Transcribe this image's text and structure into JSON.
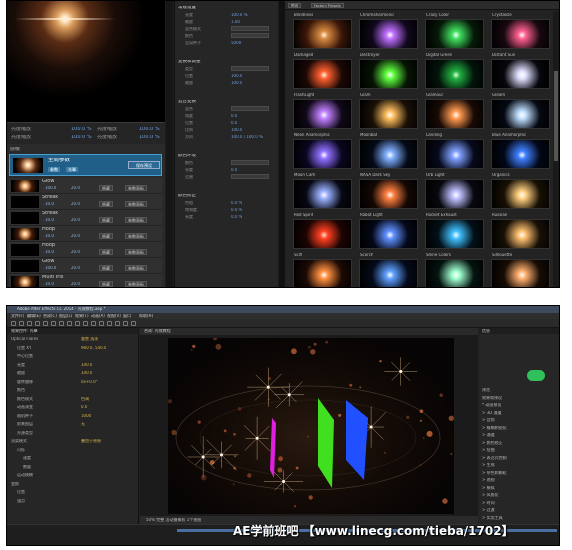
{
  "top_panel": {
    "preview_params": [
      {
        "label": "亮度缩放",
        "value": "100.0 %"
      },
      {
        "label": "亮度缩放",
        "value": "100.0 %"
      }
    ],
    "preview_params_right": [
      {
        "label": "亮度缩放",
        "value": "100.0 %"
      },
      {
        "label": "亮度缩放",
        "value": "100.0 %"
      }
    ],
    "layers_title": "层级",
    "selected_layer": {
      "name": "全局参数",
      "chip1": "参数",
      "chip2": "光晕",
      "save_label": "保存预设"
    },
    "layer_rows": [
      {
        "name": "Glow",
        "val": "100.0",
        "val2": "20.0",
        "btn1": "隐藏",
        "btn2": "参数面板"
      },
      {
        "name": "Streak",
        "val": "10.0",
        "val2": "20.0",
        "btn1": "隐藏",
        "btn2": "参数面板"
      },
      {
        "name": "Streak",
        "val": "10.0",
        "val2": "20.0",
        "btn1": "隐藏",
        "btn2": "参数面板"
      },
      {
        "name": "Hoop",
        "val": "10.0",
        "val2": "20.0",
        "btn1": "隐藏",
        "btn2": "参数面板"
      },
      {
        "name": "Hoop",
        "val": "10.0",
        "val2": "20.0",
        "btn1": "隐藏",
        "btn2": "参数面板"
      },
      {
        "name": "Glow",
        "val": "100.0",
        "val2": "20.0",
        "btn1": "隐藏",
        "btn2": "参数面板"
      },
      {
        "name": "Multi Iris",
        "val": "10.0",
        "val2": "20.0",
        "btn1": "隐藏",
        "btn2": "参数面板"
      }
    ],
    "props_sections": [
      {
        "title": "常规设置",
        "items": [
          {
            "l": "亮度",
            "v": "100.0 %"
          },
          {
            "l": "缩放",
            "v": "1.00"
          },
          {
            "l": "混合模式",
            "v": ""
          },
          {
            "l": "颜色",
            "v": ""
          },
          {
            "l": "全局种子",
            "v": "5000"
          }
        ]
      },
      {
        "title": "变换和调整",
        "items": [
          {
            "l": "类型",
            "v": ""
          },
          {
            "l": "位置",
            "v": "100.0"
          },
          {
            "l": "缩放",
            "v": "100.0"
          }
        ]
      },
      {
        "title": "混合变换",
        "items": [
          {
            "l": "混合",
            "v": ""
          },
          {
            "l": "角度",
            "v": "0.0"
          },
          {
            "l": "位置",
            "v": "0.0"
          },
          {
            "l": "比例",
            "v": "100.0"
          },
          {
            "l": "方向",
            "v": "100.0 / 100.0 %"
          }
        ]
      },
      {
        "title": "颜色环境",
        "items": [
          {
            "l": "颜色",
            "v": ""
          },
          {
            "l": "亮度",
            "v": "0.0"
          },
          {
            "l": "范围",
            "v": ""
          }
        ]
      },
      {
        "title": "颜色修正",
        "items": [
          {
            "l": "色相",
            "v": "0.0 %"
          },
          {
            "l": "饱和度",
            "v": "0.0 %"
          },
          {
            "l": "亮度",
            "v": "0.0 %"
          }
        ]
      }
    ],
    "presets_bar": [
      "预设",
      "Factory Presets"
    ],
    "presets": [
      {
        "name": "Blindness",
        "colors": [
          "#fff6e8",
          "#d88a40",
          "#3a1608"
        ]
      },
      {
        "name": "Chromaharmonic",
        "colors": [
          "#ffffff",
          "#c070ff",
          "#10081c"
        ]
      },
      {
        "name": "Crazy Color",
        "colors": [
          "#ffffff",
          "#40e060",
          "#061a08"
        ]
      },
      {
        "name": "Crystalize",
        "colors": [
          "#ffffff",
          "#ff6090",
          "#180810"
        ]
      },
      {
        "name": "Damaged",
        "colors": [
          "#fff4e0",
          "#ff6030",
          "#1c0804"
        ]
      },
      {
        "name": "Destroyer",
        "colors": [
          "#ffffff",
          "#60ff40",
          "#061404"
        ]
      },
      {
        "name": "Digital Green",
        "colors": [
          "#e0ffe0",
          "#20b040",
          "#02140a"
        ]
      },
      {
        "name": "Distant Sun",
        "colors": [
          "#ffffff",
          "#e0e0ff",
          "#06060c"
        ]
      },
      {
        "name": "FlashLight",
        "colors": [
          "#ffffff",
          "#c080ff",
          "#100818"
        ]
      },
      {
        "name": "Glam",
        "colors": [
          "#ffffff",
          "#ffc060",
          "#1a1006"
        ]
      },
      {
        "name": "Glamour",
        "colors": [
          "#ffffff",
          "#ff9a50",
          "#180a04"
        ]
      },
      {
        "name": "Gleam",
        "colors": [
          "#ffffff",
          "#c0e0ff",
          "#040812"
        ]
      },
      {
        "name": "Neon Anamorphic",
        "colors": [
          "#ffffff",
          "#9070ff",
          "#0a0620"
        ]
      },
      {
        "name": "Moonbat",
        "colors": [
          "#ffffff",
          "#80b0ff",
          "#040a18"
        ]
      },
      {
        "name": "Landing",
        "colors": [
          "#ffffff",
          "#80a0ff",
          "#060a1c"
        ]
      },
      {
        "name": "Blue Anamorphic",
        "colors": [
          "#ffffff",
          "#4080ff",
          "#020818"
        ]
      },
      {
        "name": "Moon Cam",
        "colors": [
          "#ffffff",
          "#9ab0ff",
          "#060812"
        ]
      },
      {
        "name": "NASA Dark Sky",
        "colors": [
          "#ffffff",
          "#ff8040",
          "#140804"
        ]
      },
      {
        "name": "Orb Light",
        "colors": [
          "#ffffff",
          "#c0c0ff",
          "#080810"
        ]
      },
      {
        "name": "Organics",
        "colors": [
          "#ffffff",
          "#ffd080",
          "#181004"
        ]
      },
      {
        "name": "Red Spirit",
        "colors": [
          "#ffe0d0",
          "#ff4020",
          "#1c0402"
        ]
      },
      {
        "name": "Robot Light",
        "colors": [
          "#ffffff",
          "#6090ff",
          "#040818"
        ]
      },
      {
        "name": "Rocket Exhaust",
        "colors": [
          "#ffffff",
          "#40c0ff",
          "#021018"
        ]
      },
      {
        "name": "Russian",
        "colors": [
          "#ffffff",
          "#ffc070",
          "#181006"
        ]
      },
      {
        "name": "Scifi",
        "colors": [
          "#ffffff",
          "#ff9040",
          "#1c0a04"
        ]
      },
      {
        "name": "Scorch",
        "colors": [
          "#ffffff",
          "#60a0ff",
          "#040a1a"
        ]
      },
      {
        "name": "Shine Colors",
        "colors": [
          "#ffffff",
          "#a0ffd0",
          "#041410"
        ]
      },
      {
        "name": "Silhouette",
        "colors": [
          "#ffffff",
          "#ffb070",
          "#180c04"
        ]
      }
    ]
  },
  "ae": {
    "title": "Adobe After Effects CC 2014 - 光效教程.aep *",
    "menu": [
      "文件(F)",
      "编辑(E)",
      "合成(C)",
      "图层(L)",
      "效果(T)",
      "动画(A)",
      "视图(V)",
      "窗口",
      "帮助(H)"
    ],
    "left_tabs": "效果控件: 光晕",
    "effect_rows": [
      {
        "n": "Optical Flares",
        "v": "重置 选项",
        "indent": 0
      },
      {
        "n": "位置 XY",
        "v": "960.0, 540.0",
        "indent": 1
      },
      {
        "n": "中心位置",
        "v": "",
        "indent": 1
      },
      {
        "n": "亮度",
        "v": "100.0",
        "indent": 1
      },
      {
        "n": "缩放",
        "v": "100.0",
        "indent": 1
      },
      {
        "n": "旋转偏移",
        "v": "0x+0.0°",
        "indent": 1
      },
      {
        "n": "颜色",
        "v": "",
        "indent": 1
      },
      {
        "n": "颜色模式",
        "v": "色调",
        "indent": 1
      },
      {
        "n": "动画演变",
        "v": "0.0",
        "indent": 1
      },
      {
        "n": "随机种子",
        "v": "1000",
        "indent": 1
      },
      {
        "n": "前景图层",
        "v": "无",
        "indent": 1
      },
      {
        "n": "光源类型",
        "v": "",
        "indent": 1
      },
      {
        "n": "渲染模式",
        "v": "叠加于原始",
        "indent": 0
      },
      {
        "n": "闪烁",
        "v": "",
        "indent": 1
      },
      {
        "n": "速度",
        "v": "",
        "indent": 2
      },
      {
        "n": "数量",
        "v": "",
        "indent": 2
      },
      {
        "n": "运动模糊",
        "v": "",
        "indent": 1
      },
      {
        "n": "变换",
        "v": "",
        "indent": 0
      },
      {
        "n": "位置",
        "v": "",
        "indent": 1
      },
      {
        "n": "锚点",
        "v": "",
        "indent": 1
      }
    ],
    "viewer_tab": "合成: 光效教程",
    "viewer_foot": "50%   完整   活动摄像机   1个视图",
    "right_header": "信息",
    "right_items": [
      "预览",
      "效果和预设",
      "* 动画预设",
      "> 3D 通道",
      "> 音频",
      "> 模糊和锐化",
      "> 通道",
      "> 颜色校正",
      "> 扭曲",
      "> 表达式控制",
      "> 生成",
      "> 杂色和颗粒",
      "> 透视",
      "> 模拟",
      "> 风格化",
      "> 时间",
      "> 过渡",
      "> 实用工具"
    ]
  },
  "watermark": "AE学前班吧 【www.linecg.com/tieba/1702】"
}
